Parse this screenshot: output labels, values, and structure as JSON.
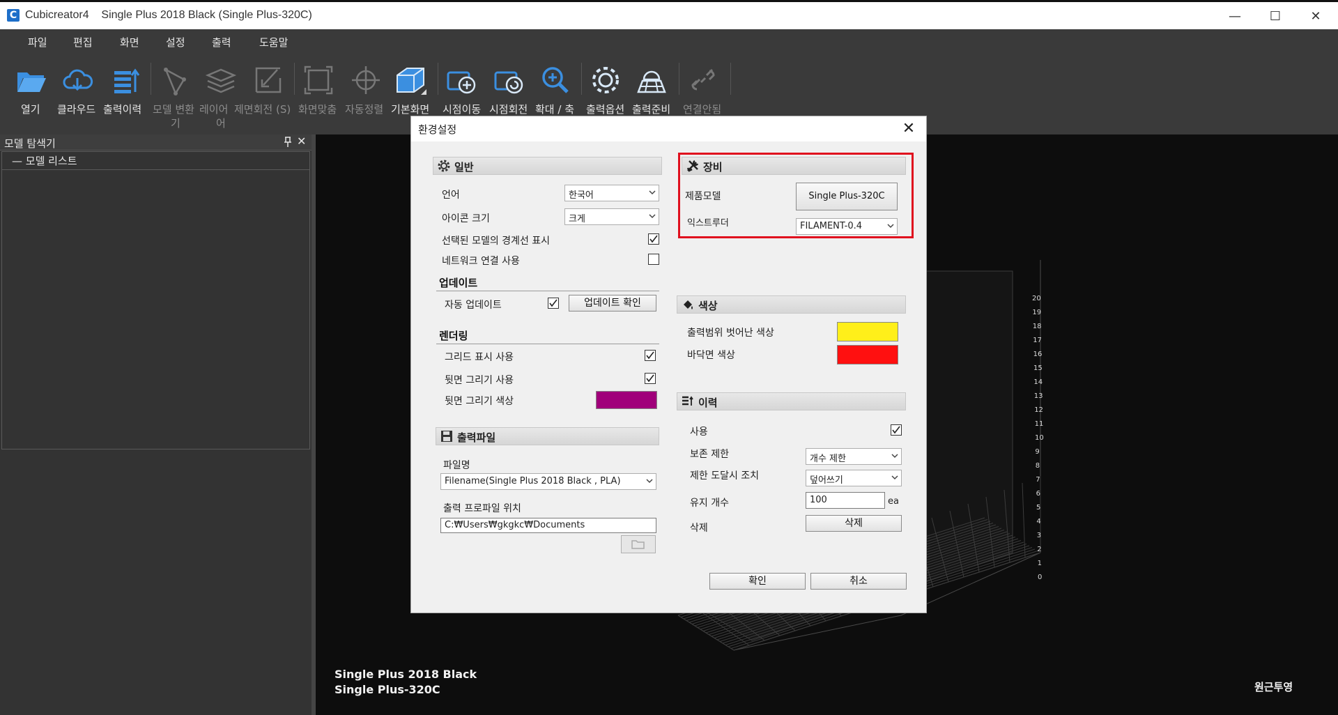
{
  "window": {
    "app_name": "Cubicreator4",
    "document_title": "Single Plus 2018 Black (Single Plus-320C)",
    "logo_letter": "C"
  },
  "menu": [
    "파일",
    "편집",
    "화면",
    "설정",
    "출력",
    "도움말"
  ],
  "toolbar": {
    "items": [
      {
        "label": "열기",
        "icon": "folder-icon",
        "enabled": true
      },
      {
        "label": "클라우드",
        "icon": "cloud-download-icon",
        "enabled": true
      },
      {
        "label": "출력이력",
        "icon": "print-history-icon",
        "enabled": true
      },
      {
        "label": "모델 변환",
        "label2": "기",
        "icon": "model-transform-icon",
        "enabled": false
      },
      {
        "label": "레이어",
        "label2": "어",
        "icon": "layers-icon",
        "enabled": false
      },
      {
        "label": "제면회전 (S)",
        "icon": "face-rotate-icon",
        "enabled": false
      },
      {
        "label": "화면맞춤",
        "icon": "fit-screen-icon",
        "enabled": false
      },
      {
        "label": "자동정렬",
        "icon": "auto-align-icon",
        "enabled": false
      },
      {
        "label": "기본화면",
        "icon": "default-view-icon",
        "enabled": true
      },
      {
        "label": "시점이동",
        "icon": "view-move-icon",
        "enabled": true
      },
      {
        "label": "시점회전",
        "icon": "view-rotate-icon",
        "enabled": true
      },
      {
        "label": "확대 / 축",
        "icon": "zoom-icon",
        "enabled": true
      },
      {
        "label": "출력옵션",
        "icon": "print-options-icon",
        "enabled": true
      },
      {
        "label": "출력준비",
        "icon": "print-prepare-icon",
        "enabled": true
      },
      {
        "label": "연결안됨",
        "icon": "disconnected-icon",
        "enabled": false
      }
    ]
  },
  "explorer": {
    "title": "모델 탐색기",
    "tree_root": "— 모델 리스트"
  },
  "viewport": {
    "printer_name": "Single Plus 2018 Black",
    "printer_model": "Single Plus-320C",
    "projection_label": "원근투영",
    "axis_ticks": [
      "20",
      "19",
      "18",
      "17",
      "16",
      "15",
      "14",
      "13",
      "12",
      "11",
      "10",
      "9",
      "8",
      "7",
      "6",
      "5",
      "4",
      "3",
      "2",
      "1",
      "0"
    ]
  },
  "dialog": {
    "title": "환경설정",
    "general": {
      "header": "일반",
      "language_label": "언어",
      "language_value": "한국어",
      "icon_size_label": "아이콘 크기",
      "icon_size_value": "크게",
      "show_bbox_label": "선택된 모델의 경계선 표시",
      "show_bbox_checked": true,
      "network_label": "네트워크 연결 사용",
      "network_checked": false
    },
    "update": {
      "header": "업데이트",
      "auto_label": "자동 업데이트",
      "auto_checked": true,
      "check_button": "업데이트 확인"
    },
    "rendering": {
      "header": "렌더링",
      "grid_label": "그리드 표시 사용",
      "grid_checked": true,
      "backface_label": "뒷면 그리기 사용",
      "backface_checked": true,
      "backface_color_label": "뒷면 그리기 색상",
      "backface_color": "#a0007a"
    },
    "output_file": {
      "header": "출력파일",
      "filename_label": "파일명",
      "filename_value": "Filename(Single Plus 2018 Black , PLA)",
      "profile_path_label": "출력 프로파일 위치",
      "profile_path_value": "C:₩Users₩gkgkc₩Documents"
    },
    "equipment": {
      "header": "장비",
      "model_label": "제품모델",
      "model_button": "Single Plus-320C",
      "extruder_label": "익스트루더",
      "extruder_value": "FILAMENT-0.4",
      "highlight_color": "#e0101e"
    },
    "color": {
      "header": "색상",
      "out_of_range_label": "출력범위 벗어난 색상",
      "out_of_range_color": "#ffef1a",
      "floor_label": "바닥면 색상",
      "floor_color": "#ff1010"
    },
    "history": {
      "header": "이력",
      "use_label": "사용",
      "use_checked": true,
      "retention_label": "보존 제한",
      "retention_value": "개수 제한",
      "limit_action_label": "제한 도달시 조치",
      "limit_action_value": "덮어쓰기",
      "keep_count_label": "유지 개수",
      "keep_count_value": "100",
      "keep_count_unit": "ea",
      "delete_label": "삭제",
      "delete_button": "삭제"
    },
    "ok_button": "확인",
    "cancel_button": "취소"
  }
}
